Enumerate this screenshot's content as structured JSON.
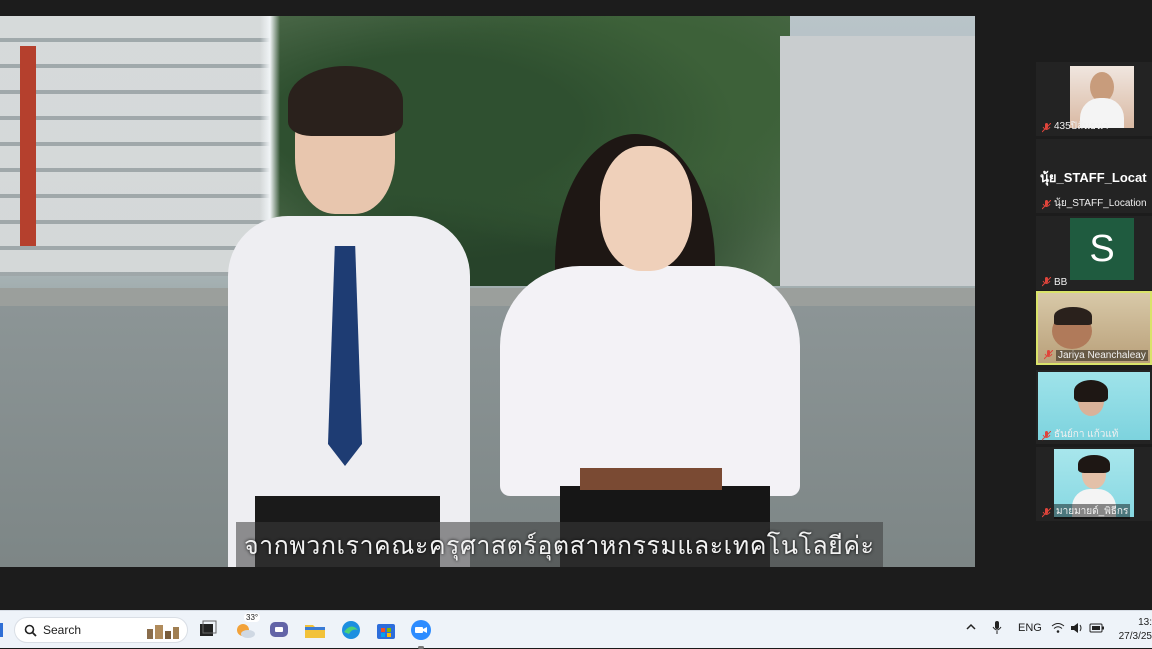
{
  "video": {
    "subtitle": "จากพวกเราคณะครุศาสตร์อุตสาหกรรมและเทคโนโลยีค่ะ"
  },
  "participants": [
    {
      "name": "435ปิลันธนา",
      "muted": true
    },
    {
      "name": "นุ้ย_STAFF_Location",
      "display_label": "นุ้ย_STAFF_Locat",
      "muted": true
    },
    {
      "name": "BB",
      "avatar_letter": "S",
      "muted": true
    },
    {
      "name": "Jariya Neanchaleay",
      "muted": true,
      "active_speaker": true
    },
    {
      "name": "ธันย์กา แก้วแท้",
      "muted": true
    },
    {
      "name": "มายมายด์_พิธีกร",
      "muted": true
    }
  ],
  "taskbar": {
    "search_placeholder": "Search",
    "weather_temp": "33°",
    "language": "ENG",
    "time": "13:",
    "date": "27/3/25"
  },
  "colors": {
    "active_speaker_border": "#d9e36a",
    "mute_icon": "#e0443b",
    "avatar_bg": "#1f5b3f",
    "taskbar_bg": "#eef3f9"
  }
}
